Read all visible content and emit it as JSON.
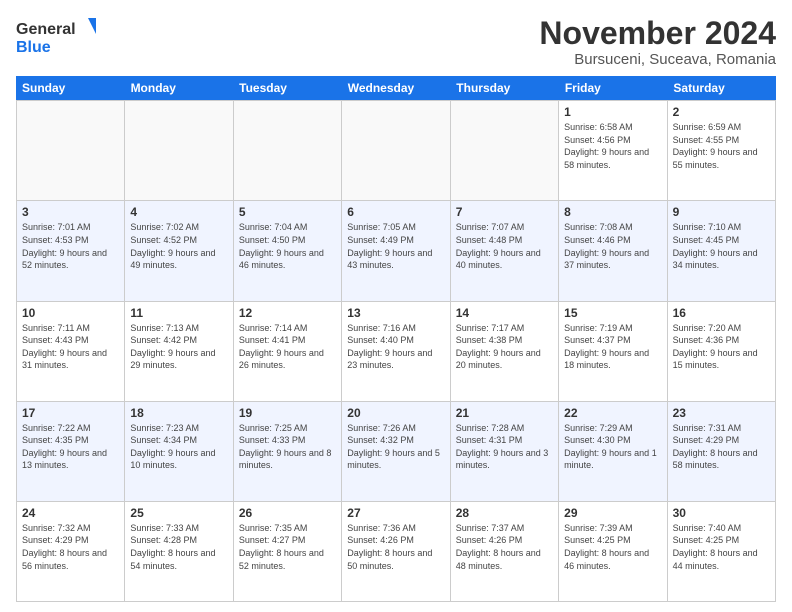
{
  "logo": {
    "line1": "General",
    "line2": "Blue"
  },
  "title": "November 2024",
  "location": "Bursuceni, Suceava, Romania",
  "days_of_week": [
    "Sunday",
    "Monday",
    "Tuesday",
    "Wednesday",
    "Thursday",
    "Friday",
    "Saturday"
  ],
  "weeks": [
    [
      {
        "day": "",
        "info": ""
      },
      {
        "day": "",
        "info": ""
      },
      {
        "day": "",
        "info": ""
      },
      {
        "day": "",
        "info": ""
      },
      {
        "day": "",
        "info": ""
      },
      {
        "day": "1",
        "info": "Sunrise: 6:58 AM\nSunset: 4:56 PM\nDaylight: 9 hours and 58 minutes."
      },
      {
        "day": "2",
        "info": "Sunrise: 6:59 AM\nSunset: 4:55 PM\nDaylight: 9 hours and 55 minutes."
      }
    ],
    [
      {
        "day": "3",
        "info": "Sunrise: 7:01 AM\nSunset: 4:53 PM\nDaylight: 9 hours and 52 minutes."
      },
      {
        "day": "4",
        "info": "Sunrise: 7:02 AM\nSunset: 4:52 PM\nDaylight: 9 hours and 49 minutes."
      },
      {
        "day": "5",
        "info": "Sunrise: 7:04 AM\nSunset: 4:50 PM\nDaylight: 9 hours and 46 minutes."
      },
      {
        "day": "6",
        "info": "Sunrise: 7:05 AM\nSunset: 4:49 PM\nDaylight: 9 hours and 43 minutes."
      },
      {
        "day": "7",
        "info": "Sunrise: 7:07 AM\nSunset: 4:48 PM\nDaylight: 9 hours and 40 minutes."
      },
      {
        "day": "8",
        "info": "Sunrise: 7:08 AM\nSunset: 4:46 PM\nDaylight: 9 hours and 37 minutes."
      },
      {
        "day": "9",
        "info": "Sunrise: 7:10 AM\nSunset: 4:45 PM\nDaylight: 9 hours and 34 minutes."
      }
    ],
    [
      {
        "day": "10",
        "info": "Sunrise: 7:11 AM\nSunset: 4:43 PM\nDaylight: 9 hours and 31 minutes."
      },
      {
        "day": "11",
        "info": "Sunrise: 7:13 AM\nSunset: 4:42 PM\nDaylight: 9 hours and 29 minutes."
      },
      {
        "day": "12",
        "info": "Sunrise: 7:14 AM\nSunset: 4:41 PM\nDaylight: 9 hours and 26 minutes."
      },
      {
        "day": "13",
        "info": "Sunrise: 7:16 AM\nSunset: 4:40 PM\nDaylight: 9 hours and 23 minutes."
      },
      {
        "day": "14",
        "info": "Sunrise: 7:17 AM\nSunset: 4:38 PM\nDaylight: 9 hours and 20 minutes."
      },
      {
        "day": "15",
        "info": "Sunrise: 7:19 AM\nSunset: 4:37 PM\nDaylight: 9 hours and 18 minutes."
      },
      {
        "day": "16",
        "info": "Sunrise: 7:20 AM\nSunset: 4:36 PM\nDaylight: 9 hours and 15 minutes."
      }
    ],
    [
      {
        "day": "17",
        "info": "Sunrise: 7:22 AM\nSunset: 4:35 PM\nDaylight: 9 hours and 13 minutes."
      },
      {
        "day": "18",
        "info": "Sunrise: 7:23 AM\nSunset: 4:34 PM\nDaylight: 9 hours and 10 minutes."
      },
      {
        "day": "19",
        "info": "Sunrise: 7:25 AM\nSunset: 4:33 PM\nDaylight: 9 hours and 8 minutes."
      },
      {
        "day": "20",
        "info": "Sunrise: 7:26 AM\nSunset: 4:32 PM\nDaylight: 9 hours and 5 minutes."
      },
      {
        "day": "21",
        "info": "Sunrise: 7:28 AM\nSunset: 4:31 PM\nDaylight: 9 hours and 3 minutes."
      },
      {
        "day": "22",
        "info": "Sunrise: 7:29 AM\nSunset: 4:30 PM\nDaylight: 9 hours and 1 minute."
      },
      {
        "day": "23",
        "info": "Sunrise: 7:31 AM\nSunset: 4:29 PM\nDaylight: 8 hours and 58 minutes."
      }
    ],
    [
      {
        "day": "24",
        "info": "Sunrise: 7:32 AM\nSunset: 4:29 PM\nDaylight: 8 hours and 56 minutes."
      },
      {
        "day": "25",
        "info": "Sunrise: 7:33 AM\nSunset: 4:28 PM\nDaylight: 8 hours and 54 minutes."
      },
      {
        "day": "26",
        "info": "Sunrise: 7:35 AM\nSunset: 4:27 PM\nDaylight: 8 hours and 52 minutes."
      },
      {
        "day": "27",
        "info": "Sunrise: 7:36 AM\nSunset: 4:26 PM\nDaylight: 8 hours and 50 minutes."
      },
      {
        "day": "28",
        "info": "Sunrise: 7:37 AM\nSunset: 4:26 PM\nDaylight: 8 hours and 48 minutes."
      },
      {
        "day": "29",
        "info": "Sunrise: 7:39 AM\nSunset: 4:25 PM\nDaylight: 8 hours and 46 minutes."
      },
      {
        "day": "30",
        "info": "Sunrise: 7:40 AM\nSunset: 4:25 PM\nDaylight: 8 hours and 44 minutes."
      }
    ]
  ]
}
